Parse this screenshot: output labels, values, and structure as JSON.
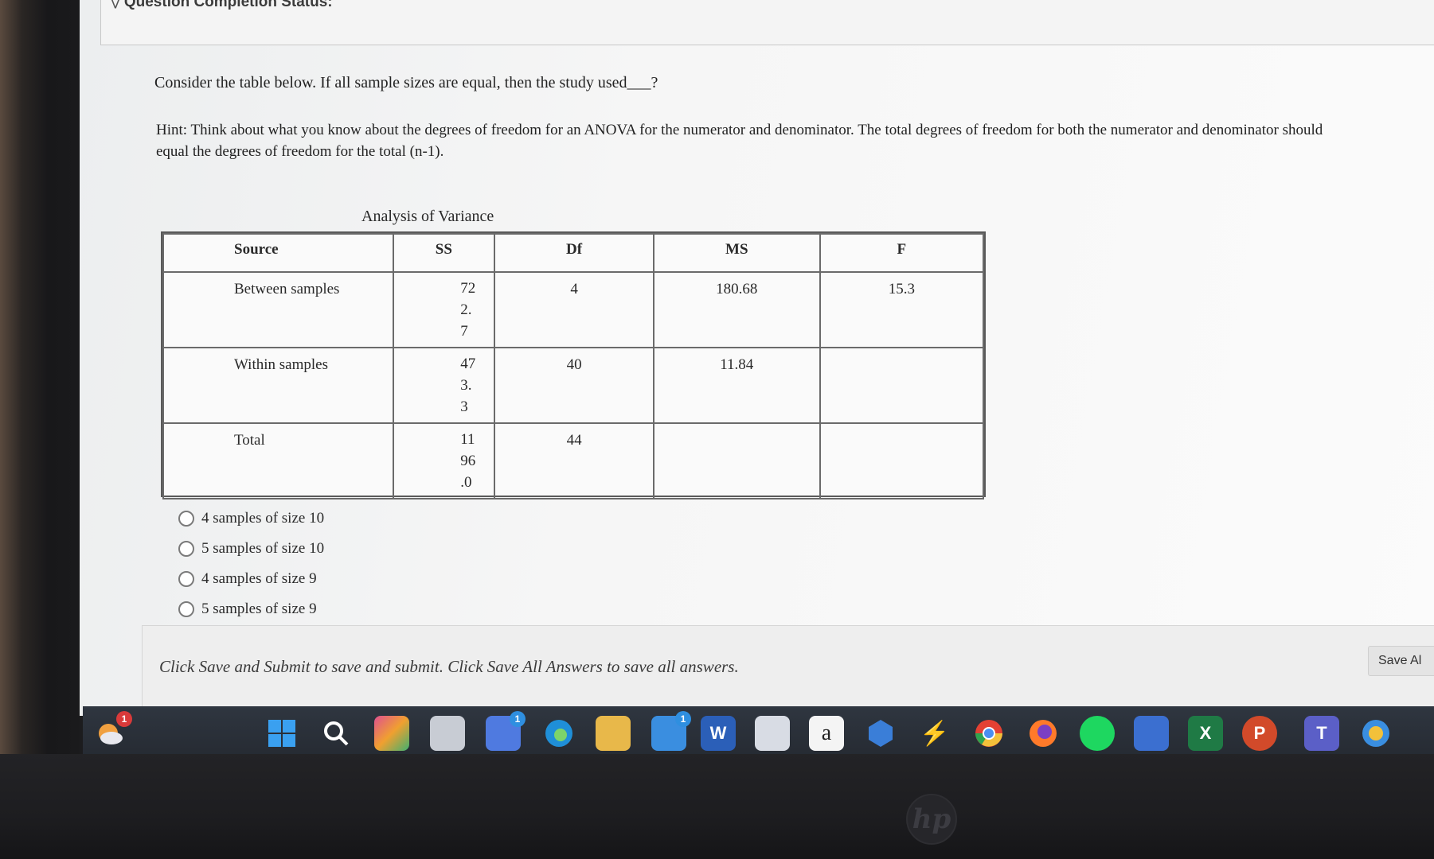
{
  "status": {
    "title": "Question Completion Status:"
  },
  "question": {
    "text": "Consider the table below. If all sample sizes are equal, then the study used___?"
  },
  "hint": {
    "text": "Hint: Think about what you know about the degrees of freedom for an ANOVA for the numerator and denominator. The total degrees of freedom for both the numerator and denominator should equal the degrees of freedom for the total (n-1)."
  },
  "table": {
    "caption": "Analysis of Variance",
    "headers": [
      "Source",
      "SS",
      "Df",
      "MS",
      "F"
    ],
    "rows": [
      {
        "source": "Between samples",
        "ss": [
          "72",
          "2.",
          "7"
        ],
        "df": "4",
        "ms": "180.68",
        "f": "15.3"
      },
      {
        "source": "Within samples",
        "ss": [
          "47",
          "3.",
          "3"
        ],
        "df": "40",
        "ms": "11.84",
        "f": ""
      },
      {
        "source": "Total",
        "ss": [
          "11",
          "96",
          ".0"
        ],
        "df": "44",
        "ms": "",
        "f": ""
      }
    ]
  },
  "options": [
    "4 samples of size 10",
    "5 samples of size 10",
    "4 samples of size 9",
    "5 samples of size 9"
  ],
  "footer": {
    "instructions": "Click Save and Submit to save and submit. Click Save All Answers to save all answers.",
    "save_all_label": "Save Al"
  },
  "taskbar": {
    "notification_count": "1",
    "store_badge": "1",
    "mail_badge": "1",
    "amazon_label": "a",
    "word_label": "W",
    "excel_label": "X",
    "powerpoint_label": "P",
    "teams_label": "T"
  },
  "brand": {
    "logo_text": "hp"
  }
}
